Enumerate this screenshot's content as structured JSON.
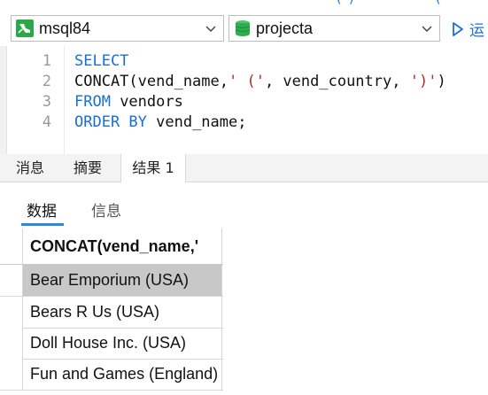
{
  "toolbar": {
    "connection": {
      "name": "msql84"
    },
    "database": {
      "name": "projecta"
    },
    "run": {
      "label": "运"
    }
  },
  "editor": {
    "lines": [
      {
        "number": "1",
        "tokens": [
          {
            "t": "SELECT",
            "c": "kw"
          }
        ]
      },
      {
        "number": "2",
        "tokens": [
          {
            "t": "CONCAT(vend_name,",
            "c": "plain"
          },
          {
            "t": "' ('",
            "c": "str"
          },
          {
            "t": ", vend_country, ",
            "c": "plain"
          },
          {
            "t": "')'",
            "c": "str"
          },
          {
            "t": ")",
            "c": "plain"
          }
        ]
      },
      {
        "number": "3",
        "tokens": [
          {
            "t": "FROM",
            "c": "kw"
          },
          {
            "t": " vendors",
            "c": "plain"
          }
        ]
      },
      {
        "number": "4",
        "tokens": [
          {
            "t": "ORDER BY",
            "c": "kw"
          },
          {
            "t": " vend_name;",
            "c": "plain"
          }
        ]
      }
    ]
  },
  "result_tabs": [
    {
      "label": "消息",
      "active": false
    },
    {
      "label": "摘要",
      "active": false
    },
    {
      "label": "结果 1",
      "active": true
    }
  ],
  "sub_tabs": [
    {
      "label": "数据",
      "active": true
    },
    {
      "label": "信息",
      "active": false
    }
  ],
  "grid": {
    "column_header": "CONCAT(vend_name,'",
    "rows": [
      {
        "value": "Bear Emporium (USA)",
        "selected": true
      },
      {
        "value": "Bears R Us (USA)",
        "selected": false
      },
      {
        "value": "Doll House Inc. (USA)",
        "selected": false
      },
      {
        "value": "Fun and Games (England)",
        "selected": false
      }
    ]
  },
  "colors": {
    "keyword": "#1a6fd3",
    "string": "#b52a2a",
    "accent": "#2a8bd8",
    "selected_row": "#c8c8c8",
    "connection_icon": "#2aa84a",
    "database_icon": "#2fae4e"
  }
}
